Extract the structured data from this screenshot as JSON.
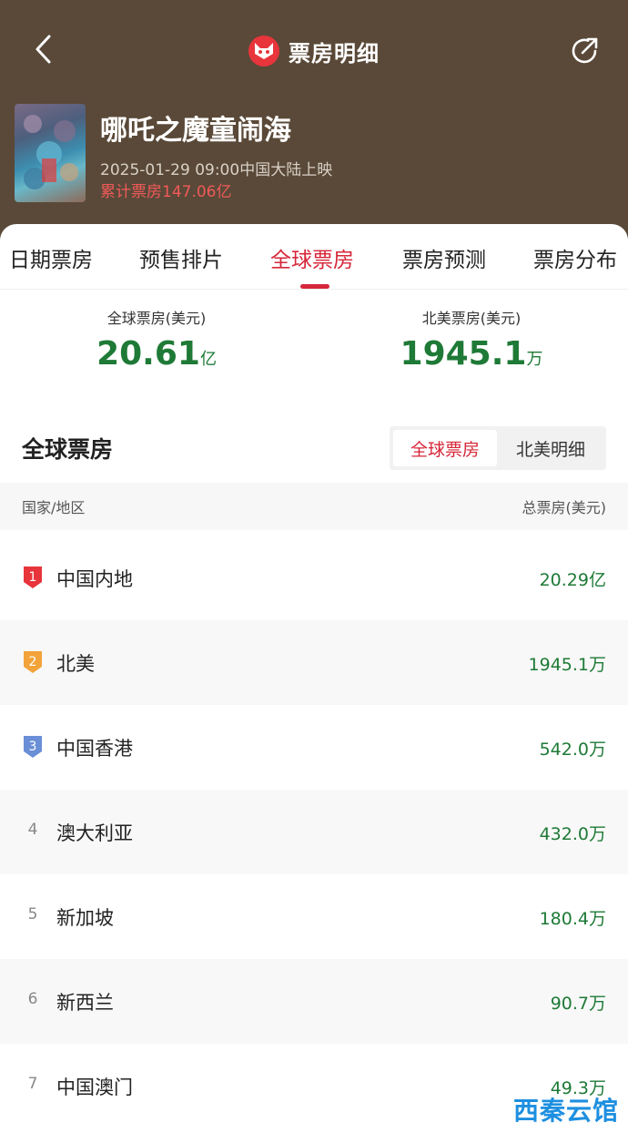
{
  "header": {
    "title": "票房明细",
    "back_icon": "back-arrow-icon",
    "share_icon": "share-icon"
  },
  "movie": {
    "title": "哪吒之魔童闹海",
    "release": "2025-01-29 09:00中国大陆上映",
    "cumulative": "累计票房147.06亿"
  },
  "tabs": [
    {
      "label": "日期票房"
    },
    {
      "label": "预售排片"
    },
    {
      "label": "全球票房"
    },
    {
      "label": "票房预测"
    },
    {
      "label": "票房分布"
    }
  ],
  "active_tab": "全球票房",
  "summary": {
    "global": {
      "label": "全球票房(美元)",
      "value": "20.61",
      "unit": "亿"
    },
    "na": {
      "label": "北美票房(美元)",
      "value": "1945.1",
      "unit": "万"
    }
  },
  "section": {
    "title": "全球票房",
    "toggle": [
      {
        "label": "全球票房"
      },
      {
        "label": "北美明细"
      }
    ]
  },
  "table": {
    "col_region": "国家/地区",
    "col_gross": "总票房(美元)",
    "rows": [
      {
        "rank": "1",
        "region": "中国内地",
        "gross": "20.29亿"
      },
      {
        "rank": "2",
        "region": "北美",
        "gross": "1945.1万"
      },
      {
        "rank": "3",
        "region": "中国香港",
        "gross": "542.0万"
      },
      {
        "rank": "4",
        "region": "澳大利亚",
        "gross": "432.0万"
      },
      {
        "rank": "5",
        "region": "新加坡",
        "gross": "180.4万"
      },
      {
        "rank": "6",
        "region": "新西兰",
        "gross": "90.7万"
      },
      {
        "rank": "7",
        "region": "中国澳门",
        "gross": "49.3万"
      }
    ]
  },
  "colors": {
    "header_bg": "#5a4938",
    "accent_red": "#d6273a",
    "value_green": "#1e7a36",
    "gold": "#f2a33a",
    "silver_blue": "#6a8fd6"
  },
  "watermark": "西秦云馆"
}
